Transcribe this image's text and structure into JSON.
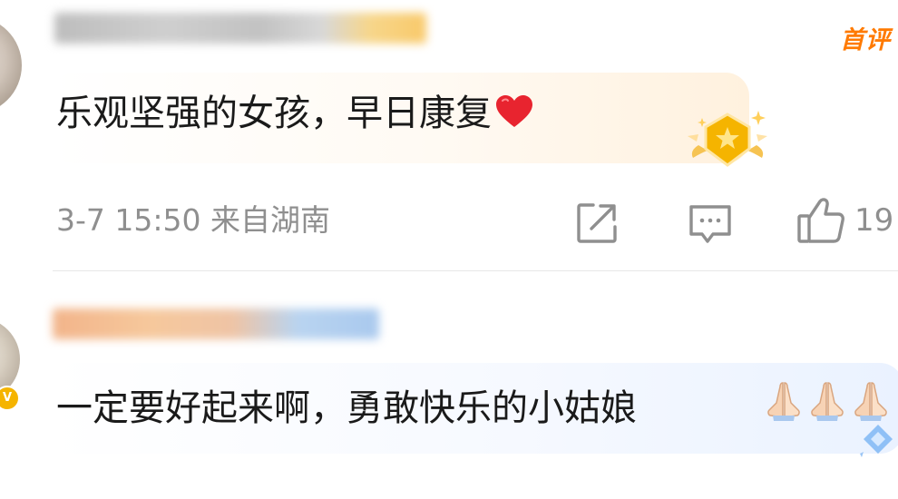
{
  "comment_1": {
    "tag": "首评",
    "text": "乐观坚强的女孩，早日康复",
    "emoji": "red-heart",
    "meta": "3-7 15:50 来自湖南",
    "like_count": "19"
  },
  "comment_2": {
    "text": "一定要好起来啊，勇敢快乐的小姑娘",
    "emoji": "folded-hands",
    "vip_badge": "V"
  },
  "colors": {
    "tag": "#ff7a00",
    "meta": "#8f8f8f",
    "comment_text": "#1a1a1a",
    "heart": "#e8242f",
    "medal": "#f5b400"
  }
}
